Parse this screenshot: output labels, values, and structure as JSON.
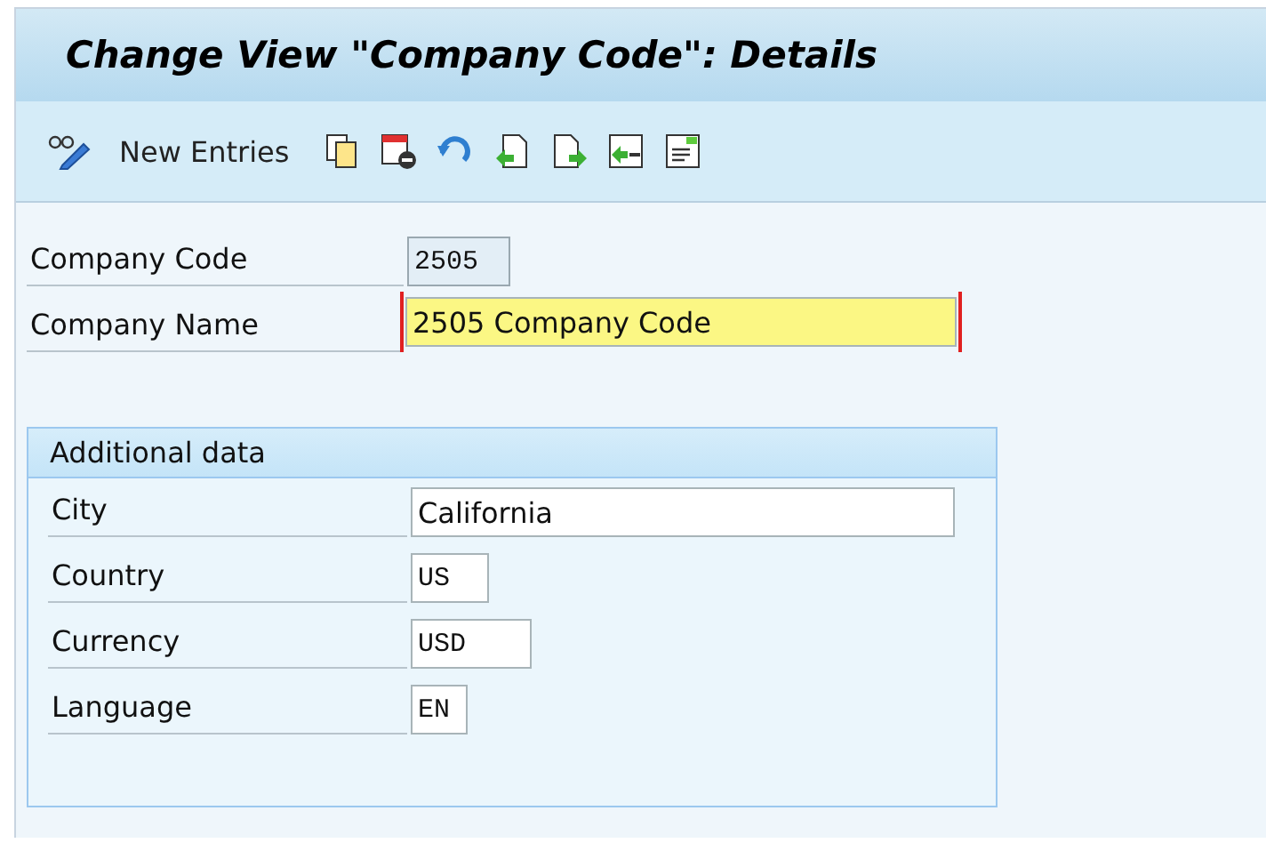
{
  "title": "Change View \"Company Code\": Details",
  "toolbar": {
    "new_entries_label": "New Entries"
  },
  "header_fields": [
    {
      "label": "Company Code",
      "value": "2505",
      "kind": "display",
      "mono": true
    },
    {
      "label": "Company Name",
      "value": "2505 Company Code",
      "kind": "focused",
      "mono": false
    }
  ],
  "group": {
    "title": "Additional data",
    "fields": [
      {
        "label": "City",
        "value": "California",
        "kind": "input",
        "mono": false
      },
      {
        "label": "Country",
        "value": "US",
        "kind": "input",
        "mono": true
      },
      {
        "label": "Currency",
        "value": "USD",
        "kind": "input",
        "mono": true
      },
      {
        "label": "Language",
        "value": "EN",
        "kind": "input",
        "mono": true
      }
    ]
  }
}
